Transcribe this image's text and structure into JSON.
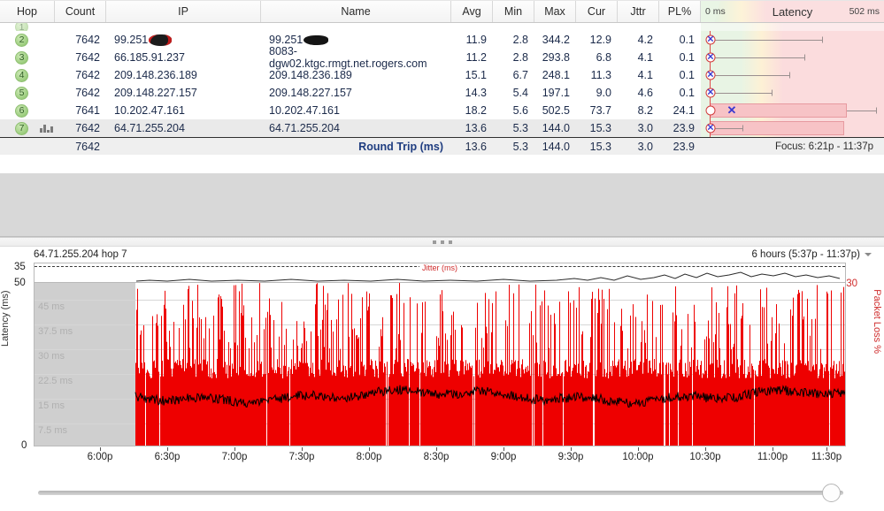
{
  "table": {
    "columns": [
      "Hop",
      "Count",
      "IP",
      "Name",
      "Avg",
      "Min",
      "Max",
      "Cur",
      "Jttr",
      "PL%"
    ],
    "latency_header": {
      "title": "Latency",
      "min_label": "0 ms",
      "max_label": "502 ms"
    },
    "rows": [
      {
        "hop": "1",
        "count": "",
        "ip": "",
        "name": "",
        "avg": "",
        "min": "",
        "max": "",
        "cur": "",
        "jttr": "",
        "pl": "",
        "clipped": true
      },
      {
        "hop": "2",
        "count": "7642",
        "ip": "99.251",
        "ip_redacted": true,
        "name": "99.251",
        "name_redacted": true,
        "avg": "11.9",
        "min": "2.8",
        "max": "344.2",
        "cur": "12.9",
        "jttr": "4.2",
        "pl": "0.1"
      },
      {
        "hop": "3",
        "count": "7642",
        "ip": "66.185.91.237",
        "name": "8083-dgw02.ktgc.rmgt.net.rogers.com",
        "avg": "11.2",
        "min": "2.8",
        "max": "293.8",
        "cur": "6.8",
        "jttr": "4.1",
        "pl": "0.1"
      },
      {
        "hop": "4",
        "count": "7642",
        "ip": "209.148.236.189",
        "name": "209.148.236.189",
        "avg": "15.1",
        "min": "6.7",
        "max": "248.1",
        "cur": "11.3",
        "jttr": "4.1",
        "pl": "0.1"
      },
      {
        "hop": "5",
        "count": "7642",
        "ip": "209.148.227.157",
        "name": "209.148.227.157",
        "avg": "14.3",
        "min": "5.4",
        "max": "197.1",
        "cur": "9.0",
        "jttr": "4.6",
        "pl": "0.1"
      },
      {
        "hop": "6",
        "count": "7641",
        "ip": "10.202.47.161",
        "name": "10.202.47.161",
        "avg": "18.2",
        "min": "5.6",
        "max": "502.5",
        "cur": "73.7",
        "jttr": "8.2",
        "pl": "24.1"
      },
      {
        "hop": "7",
        "count": "7642",
        "ip": "64.71.255.204",
        "name": "64.71.255.204",
        "avg": "13.6",
        "min": "5.3",
        "max": "144.0",
        "cur": "15.3",
        "jttr": "3.0",
        "pl": "23.9",
        "selected": true,
        "has_chart_icon": true
      }
    ],
    "summary": {
      "count": "7642",
      "label": "Round Trip (ms)",
      "avg": "13.6",
      "min": "5.3",
      "max": "144.0",
      "cur": "15.3",
      "jttr": "3.0",
      "pl": "23.9",
      "focus": "Focus: 6:21p - 11:37p"
    }
  },
  "chart_header": {
    "target": "64.71.255.204 hop 7",
    "range": "6 hours (5:37p - 11:37p)"
  },
  "chart_data": {
    "type": "area",
    "title": "64.71.255.204 hop 7",
    "subtitle": "6 hours (5:37p - 11:37p)",
    "xlabel": "",
    "ylabel": "Latency (ms)",
    "y2label": "Packet Loss %",
    "jitter_label": "Jitter (ms)",
    "jitter_max_tick": "35",
    "ylim": [
      0,
      50
    ],
    "y2lim": [
      0,
      30
    ],
    "ytick_top": "50",
    "ytick_bottom": "0",
    "y2tick_top": "30",
    "gridline_labels": [
      "45 ms",
      "37.5 ms",
      "30 ms",
      "22.5 ms",
      "15 ms",
      "7.5 ms"
    ],
    "gridline_values": [
      45,
      37.5,
      30,
      22.5,
      15,
      7.5
    ],
    "xticks": [
      "6:00p",
      "6:30p",
      "7:00p",
      "7:30p",
      "8:00p",
      "8:30p",
      "9:00p",
      "9:30p",
      "10:00p",
      "10:30p",
      "11:00p",
      "11:30p"
    ],
    "no_data_region": {
      "from": "5:37p",
      "to": "6:21p"
    },
    "grid": true,
    "legend": "none",
    "series": [
      {
        "name": "Packet Loss %",
        "color": "#ee0000",
        "type": "bar"
      },
      {
        "name": "Latency (ms)",
        "color": "#000000",
        "type": "line"
      },
      {
        "name": "Jitter (ms)",
        "color": "#3a3a3a",
        "type": "line"
      }
    ]
  },
  "colors": {
    "packet_loss": "#ee0000",
    "latency_line": "#000000",
    "jitter_line": "#3a3a3a",
    "accent_red": "#cf2b2b",
    "band_good": "#e8f4e4",
    "band_warn": "#fdf1d5",
    "band_bad": "#fbdcdd",
    "hop_badge": "#9ccd7e",
    "no_data": "#cfcfcf"
  }
}
